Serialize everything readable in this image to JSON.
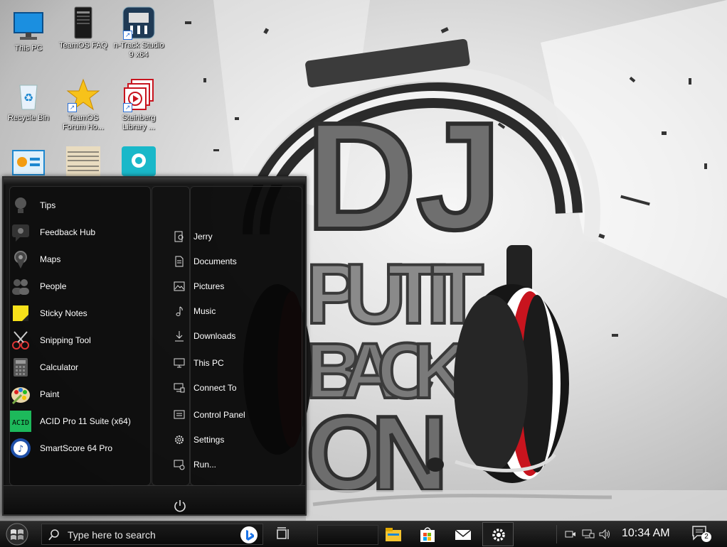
{
  "desktop_icons": [
    {
      "id": "this-pc",
      "label": "This PC"
    },
    {
      "id": "teamos-faq",
      "label": "TeamOS FAQ"
    },
    {
      "id": "ntrack",
      "label": "n-Track Studio 9 x64"
    },
    {
      "id": "recycle-bin",
      "label": "Recycle Bin"
    },
    {
      "id": "teamos-forum",
      "label": "TeamOS Forum Ho..."
    },
    {
      "id": "steinberg",
      "label": "Steinberg Library ..."
    }
  ],
  "start_menu": {
    "apps": [
      {
        "label": "Tips",
        "icon": "lightbulb-icon"
      },
      {
        "label": "Feedback Hub",
        "icon": "feedback-icon"
      },
      {
        "label": "Maps",
        "icon": "map-pin-icon"
      },
      {
        "label": "People",
        "icon": "people-icon"
      },
      {
        "label": "Sticky Notes",
        "icon": "sticky-note-icon"
      },
      {
        "label": "Snipping Tool",
        "icon": "scissors-icon"
      },
      {
        "label": "Calculator",
        "icon": "calculator-icon"
      },
      {
        "label": "Paint",
        "icon": "palette-icon"
      },
      {
        "label": "ACID Pro 11 Suite (x64)",
        "icon": "acid-icon"
      },
      {
        "label": "SmartScore 64 Pro",
        "icon": "smartscore-icon"
      }
    ],
    "places": [
      {
        "label": "Jerry",
        "icon": "user-icon"
      },
      {
        "label": "Documents",
        "icon": "document-icon"
      },
      {
        "label": "Pictures",
        "icon": "picture-icon"
      },
      {
        "label": "Music",
        "icon": "music-icon"
      },
      {
        "label": "Downloads",
        "icon": "download-icon"
      },
      {
        "label": "This PC",
        "icon": "computer-icon"
      },
      {
        "label": "Connect To",
        "icon": "connect-icon"
      },
      {
        "label": "Control Panel",
        "icon": "control-panel-icon"
      },
      {
        "label": "Settings",
        "icon": "gear-icon"
      },
      {
        "label": "Run...",
        "icon": "run-icon"
      }
    ]
  },
  "taskbar": {
    "search_placeholder": "Type here to search",
    "clock": "10:34 AM",
    "notification_count": "2"
  },
  "wallpaper": {
    "text_lines": [
      "DJ",
      "PUT IT",
      "BACK",
      "ON"
    ]
  },
  "colors": {
    "accent_red": "#c8141e",
    "taskbar": "#141414",
    "menu_bg": "#0c0c0c"
  }
}
